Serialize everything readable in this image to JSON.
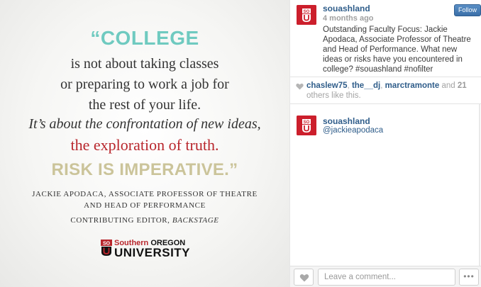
{
  "photo": {
    "quote_open": "“COLLEGE",
    "line1": "is not about taking classes",
    "line2": "or preparing to work a job for",
    "line3": "the rest of your life.",
    "line4": "It’s about the confrontation of new ideas,",
    "line5": "the exploration of truth.",
    "line6": "RISK IS IMPERATIVE.”",
    "attribution1": "JACKIE APODACA, ASSOCIATE PROFESSOR OF THEATRE",
    "attribution2": "AND HEAD OF PERFORMANCE",
    "attribution3_prefix": "CONTRIBUTING EDITOR, ",
    "attribution3_italic": "BACKSTAGE",
    "logo_top_red": "Southern ",
    "logo_top_dark": "OREGON",
    "logo_bottom": "UNIVERSITY",
    "colors": {
      "teal": "#6fcac0",
      "red": "#b8262c",
      "gold": "#cbc49a"
    }
  },
  "post": {
    "username": "souashland",
    "time": "4 months ago",
    "follow_label": "Follow",
    "caption": "Outstanding Faculty Focus: Jackie Apodaca, Associate Professor of Theatre and Head of Performance. What new ideas or risks have you encountered in college? #souashland #nofilter"
  },
  "likes": {
    "users": [
      "chaslew75",
      "the__dj",
      "marctramonte"
    ],
    "sep1": ", ",
    "sep2": ", ",
    "and": " and ",
    "count": "21",
    "suffix": " others like this."
  },
  "comments": [
    {
      "username": "souashland",
      "text": "@jackieapodaca"
    }
  ],
  "footer": {
    "placeholder": "Leave a comment...",
    "more_label": "•••"
  },
  "icons": {
    "heart": "heart-icon",
    "more": "more-options-icon"
  }
}
